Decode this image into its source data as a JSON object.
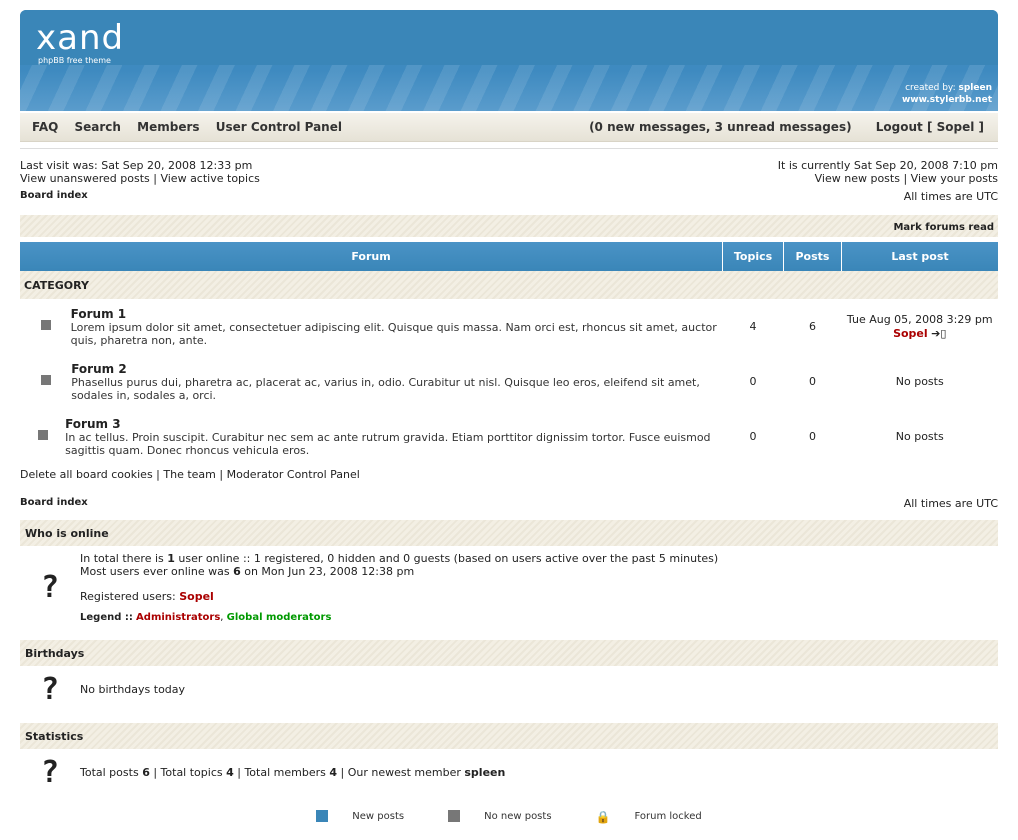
{
  "header": {
    "logo": "xand",
    "logo_sub": "phpBB free theme",
    "credit_prefix": "created by:",
    "credit_name": "spleen",
    "credit_url": "www.stylerbb.net"
  },
  "nav": {
    "faq": "FAQ",
    "search": "Search",
    "members": "Members",
    "ucp": "User Control Panel",
    "messages": "(0 new messages, 3 unread messages)",
    "logout": "Logout [ Sopel ]"
  },
  "info": {
    "last_visit": "Last visit was: Sat Sep 20, 2008 12:33 pm",
    "view_unanswered": "View unanswered posts",
    "view_active": "View active topics",
    "current_time": "It is currently Sat Sep 20, 2008 7:10 pm",
    "view_new": "View new posts",
    "view_yours": "View your posts"
  },
  "crumbs": {
    "board_index": "Board index",
    "timezone": "All times are UTC"
  },
  "mark_read": "Mark forums read",
  "table": {
    "col_forum": "Forum",
    "col_topics": "Topics",
    "col_posts": "Posts",
    "col_last": "Last post",
    "category": "CATEGORY"
  },
  "forums": [
    {
      "name": "Forum 1",
      "desc": "Lorem ipsum dolor sit amet, consectetuer adipiscing elit. Quisque quis massa. Nam orci est, rhoncus sit amet, auctor quis, pharetra non, ante.",
      "topics": "4",
      "posts": "6",
      "last_date": "Tue Aug 05, 2008 3:29 pm",
      "last_user": "Sopel"
    },
    {
      "name": "Forum 2",
      "desc": "Phasellus purus dui, pharetra ac, placerat ac, varius in, odio. Curabitur ut nisl. Quisque leo eros, eleifend sit amet, sodales in, sodales a, orci.",
      "topics": "0",
      "posts": "0",
      "last_date": "No posts",
      "last_user": ""
    },
    {
      "name": "Forum 3",
      "desc": "In ac tellus. Proin suscipit. Curabitur nec sem ac ante rutrum gravida. Etiam porttitor dignissim tortor. Fusce euismod sagittis quam. Donec rhoncus vehicula eros.",
      "topics": "0",
      "posts": "0",
      "last_date": "No posts",
      "last_user": ""
    }
  ],
  "footer_links": {
    "delete_cookies": "Delete all board cookies",
    "team": "The team",
    "mcp": "Moderator Control Panel"
  },
  "online": {
    "title": "Who is online",
    "line1_pre": "In total there is",
    "line1_count": "1",
    "line1_post": "user online :: 1 registered, 0 hidden and 0 guests (based on users active over the past 5 minutes)",
    "line2_pre": "Most users ever online was",
    "line2_count": "6",
    "line2_post": "on Mon Jun 23, 2008 12:38 pm",
    "registered_label": "Registered users:",
    "registered_user": "Sopel",
    "legend_label": "Legend ::",
    "admins": "Administrators",
    "gmods": "Global moderators"
  },
  "birthdays": {
    "title": "Birthdays",
    "text": "No birthdays today"
  },
  "stats": {
    "title": "Statistics",
    "posts_label": "Total posts",
    "posts": "6",
    "topics_label": "Total topics",
    "topics": "4",
    "members_label": "Total members",
    "members": "4",
    "newest_label": "Our newest member",
    "newest": "spleen"
  },
  "legend": {
    "new_posts": "New posts",
    "no_new_posts": "No new posts",
    "locked": "Forum locked"
  },
  "colors": {
    "accent": "#3a86b8",
    "admin": "#aa0000",
    "gmod": "#009900"
  }
}
